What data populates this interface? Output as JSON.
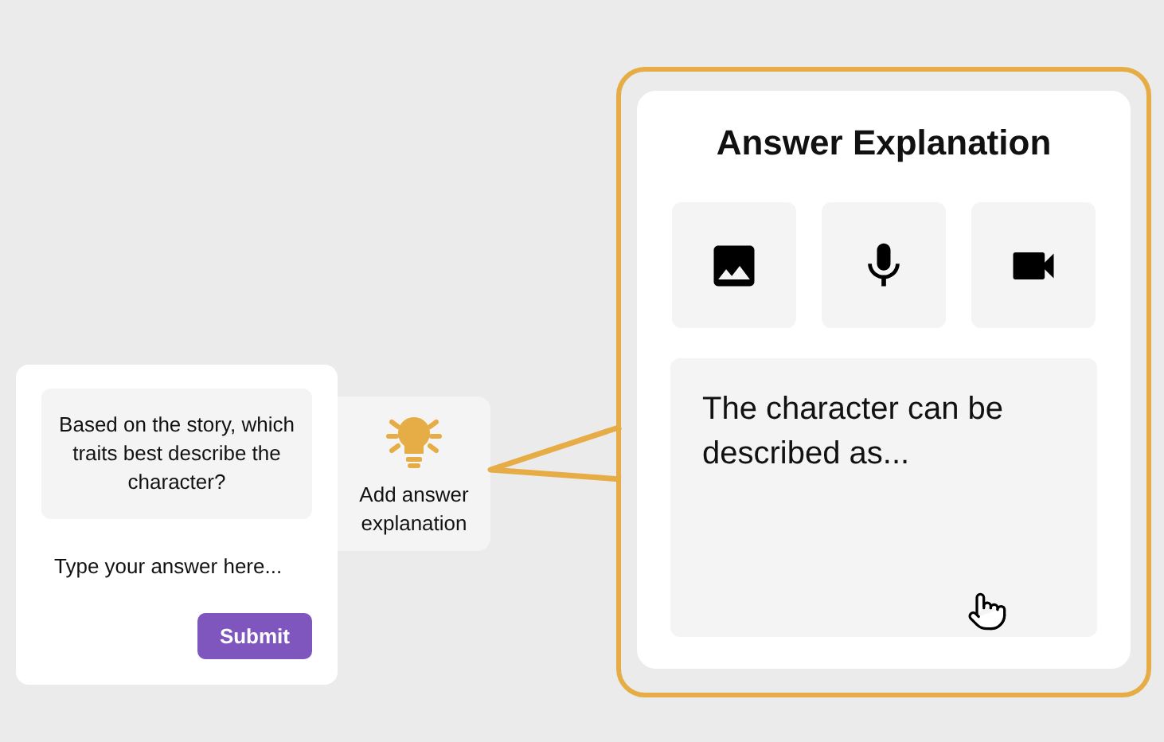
{
  "question_card": {
    "prompt": "Based on the story, which traits best describe the character?",
    "answer": {
      "placeholder": "Type your answer here..."
    },
    "submit_button": "Submit"
  },
  "add_explanation": {
    "label": "Add answer explanation"
  },
  "explanation_panel": {
    "title": "Answer Explanation",
    "media_buttons": [
      {
        "kind": "image"
      },
      {
        "kind": "audio"
      },
      {
        "kind": "video"
      }
    ],
    "text": "The character can be described as..."
  }
}
